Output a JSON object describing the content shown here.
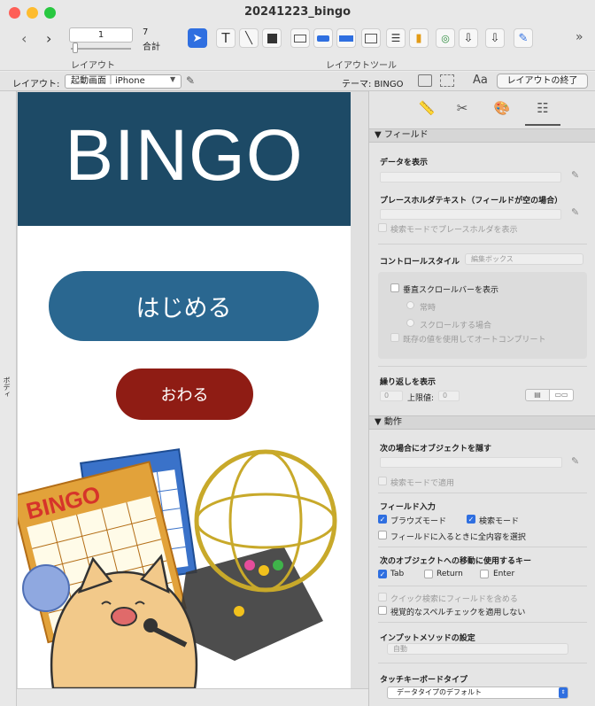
{
  "window": {
    "title": "20241223_bingo"
  },
  "toolbar": {
    "page_value": "1",
    "record_count": "7",
    "total_label": "合計",
    "layout_group_label": "レイアウト",
    "tools_group_label": "レイアウトツール"
  },
  "layoutbar": {
    "layout_label": "レイアウト:",
    "layout_value": "起動画面｜iPhone",
    "theme_label": "テーマ: BINGO",
    "exit_button": "レイアウトの終了"
  },
  "ruler": {
    "part_label": "ボディ"
  },
  "device": {
    "header_title": "BINGO",
    "start_button": "はじめる",
    "end_button": "おわる",
    "bingo_card_text": "BINGO"
  },
  "inspector": {
    "field_section": "▼ フィールド",
    "show_data_label": "データを表示",
    "placeholder_label": "プレースホルダテキスト（フィールドが空の場合）",
    "placeholder_find_mode": "検索モードでプレースホルダを表示",
    "control_style_label": "コントロールスタイル",
    "control_style_value": "編集ボックス",
    "vertical_scrollbar": "垂直スクロールバーを表示",
    "scroll_always": "常時",
    "scroll_when_scrolling": "スクロールする場合",
    "autocomplete": "既存の値を使用してオートコンプリート",
    "repeat_label": "繰り返しを表示",
    "repeat_start": "0",
    "upper_limit_label": "上限値:",
    "upper_limit_value": "0",
    "behavior_section": "▼ 動作",
    "hide_object_label": "次の場合にオブジェクトを隠す",
    "apply_find_mode": "検索モードで適用",
    "field_entry_label": "フィールド入力",
    "browse_mode": "ブラウズモード",
    "find_mode": "検索モード",
    "select_all_on_entry": "フィールドに入るときに全内容を選択",
    "next_object_label": "次のオブジェクトへの移動に使用するキー",
    "key_tab": "Tab",
    "key_return": "Return",
    "key_enter": "Enter",
    "quick_find": "クイック検索にフィールドを含める",
    "no_visual_spellcheck": "視覚的なスペルチェックを適用しない",
    "input_method_label": "インプットメソッドの設定",
    "input_method_value": "自動",
    "touch_keyboard_label": "タッチキーボードタイプ",
    "touch_keyboard_value": "データタイプのデフォルト"
  },
  "colors": {
    "header_bg": "#1d4a66",
    "start_button": "#2a6790",
    "end_button": "#8f1c14",
    "accent": "#2f6fe0"
  }
}
